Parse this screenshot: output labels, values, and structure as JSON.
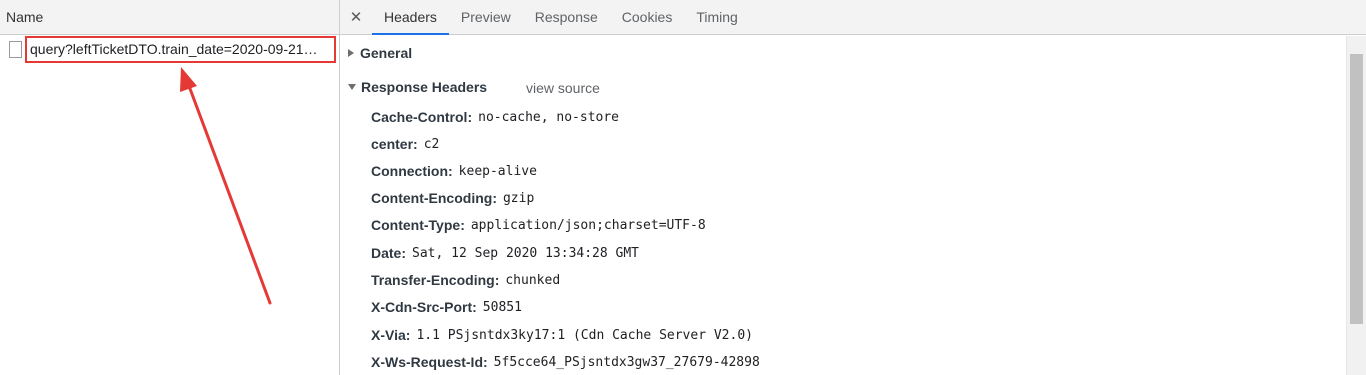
{
  "left": {
    "column_header": "Name",
    "request_name": "query?leftTicketDTO.train_date=2020-09-21…"
  },
  "tabs": {
    "close_glyph": "✕",
    "items": [
      "Headers",
      "Preview",
      "Response",
      "Cookies",
      "Timing"
    ],
    "active": "Headers"
  },
  "general": {
    "label": "General"
  },
  "response_headers": {
    "label": "Response Headers",
    "view_source": "view source",
    "items": [
      {
        "key": "Cache-Control",
        "value": "no-cache, no-store"
      },
      {
        "key": "center",
        "value": "c2"
      },
      {
        "key": "Connection",
        "value": "keep-alive"
      },
      {
        "key": "Content-Encoding",
        "value": "gzip"
      },
      {
        "key": "Content-Type",
        "value": "application/json;charset=UTF-8"
      },
      {
        "key": "Date",
        "value": "Sat, 12 Sep 2020 13:34:28 GMT"
      },
      {
        "key": "Transfer-Encoding",
        "value": "chunked"
      },
      {
        "key": "X-Cdn-Src-Port",
        "value": "50851"
      },
      {
        "key": "X-Via",
        "value": "1.1 PSjsntdx3ky17:1 (Cdn Cache Server V2.0)"
      },
      {
        "key": "X-Ws-Request-Id",
        "value": "5f5cce64_PSjsntdx3gw37_27679-42898"
      }
    ]
  },
  "colors": {
    "highlight_red": "#e53935",
    "tab_underline": "#1a73e8"
  },
  "icons": {
    "file": "file-icon",
    "close": "close-icon",
    "collapsed": "triangle-right-icon",
    "expanded": "triangle-down-icon"
  }
}
